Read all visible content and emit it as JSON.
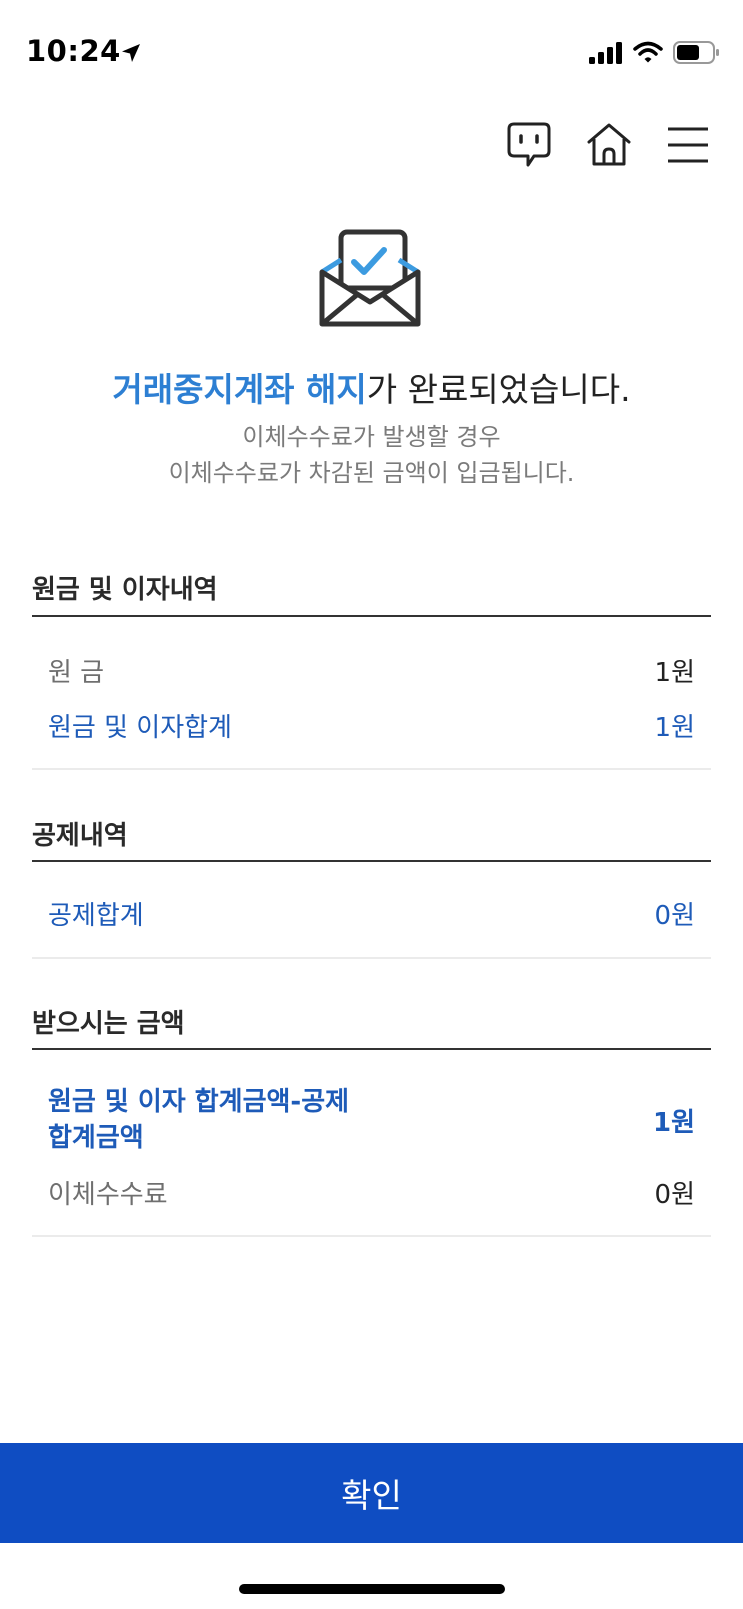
{
  "status_bar": {
    "time": "10:24"
  },
  "completion": {
    "highlight": "거래중지계좌 해지",
    "rest": "가 완료되었습니다.",
    "subtext_line1": "이체수수료가 발생할 경우",
    "subtext_line2": "이체수수료가 차감된 금액이 입금됩니다."
  },
  "principal_section": {
    "title": "원금 및 이자내역",
    "rows": [
      {
        "label": "원 금",
        "value": "1원"
      },
      {
        "label": "원금 및 이자합계",
        "value": "1원"
      }
    ]
  },
  "deduction_section": {
    "title": "공제내역",
    "rows": [
      {
        "label": "공제합계",
        "value": "0원"
      }
    ]
  },
  "received_section": {
    "title": "받으시는 금액",
    "rows": [
      {
        "label_line1": "원금 및 이자 합계금액-공제",
        "label_line2": "합계금액",
        "value": "1원"
      },
      {
        "label": "이체수수료",
        "value": "0원"
      }
    ]
  },
  "confirm_button": {
    "label": "확인"
  },
  "colors": {
    "accent": "#2d7fd3",
    "blue_text": "#1e5bb8",
    "button": "#0f4dc2"
  }
}
